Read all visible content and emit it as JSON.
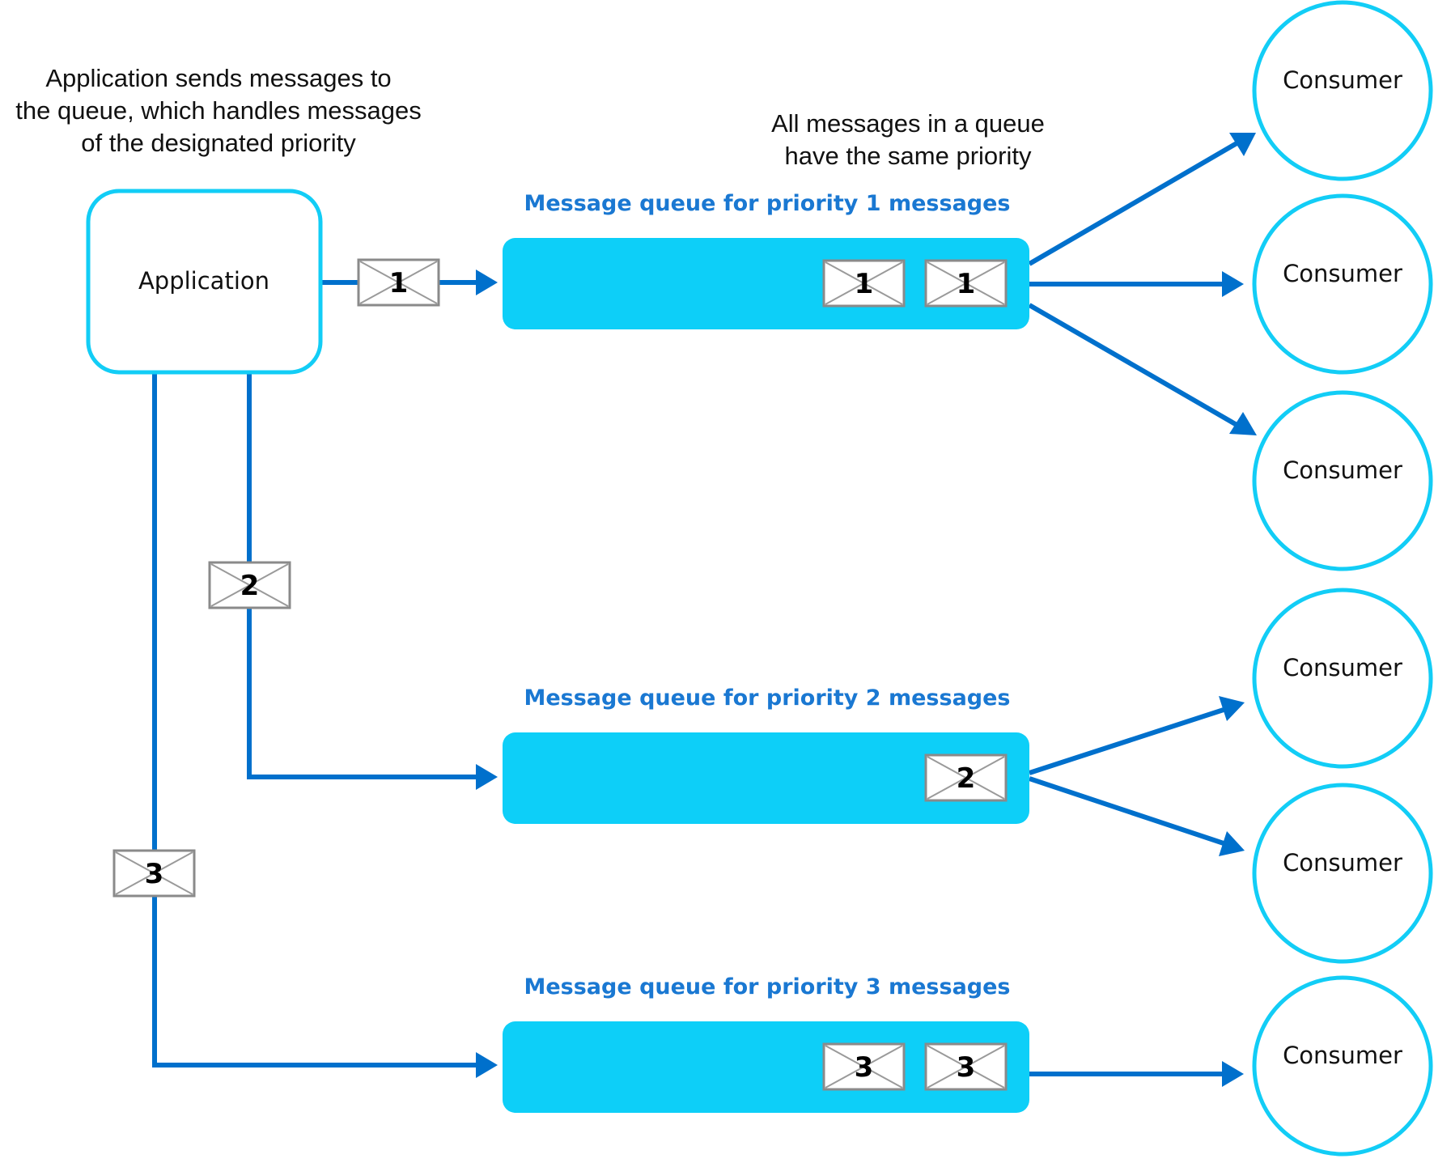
{
  "notes": {
    "application_note": [
      "Application sends messages to",
      "the queue, which handles messages",
      "of the designated priority"
    ],
    "queue_note": [
      "All messages in a queue",
      "have the same priority"
    ]
  },
  "application": {
    "label": "Application"
  },
  "queues": [
    {
      "label": "Message queue for priority 1 messages",
      "priority": "1",
      "messages": [
        "1",
        "1"
      ]
    },
    {
      "label": "Message queue for priority 2 messages",
      "priority": "2",
      "messages": [
        "2"
      ]
    },
    {
      "label": "Message queue for priority 3 messages",
      "priority": "3",
      "messages": [
        "3",
        "3"
      ]
    }
  ],
  "in_transit_messages": [
    {
      "priority": "1",
      "to_queue": 1
    },
    {
      "priority": "2",
      "to_queue": 2
    },
    {
      "priority": "3",
      "to_queue": 3
    }
  ],
  "consumers": [
    {
      "label": "Consumer",
      "queue": 1
    },
    {
      "label": "Consumer",
      "queue": 1
    },
    {
      "label": "Consumer",
      "queue": 1
    },
    {
      "label": "Consumer",
      "queue": 2
    },
    {
      "label": "Consumer",
      "queue": 2
    },
    {
      "label": "Consumer",
      "queue": 3
    }
  ],
  "colors": {
    "connector": "#0070cc",
    "queue_fill": "#0dcff8",
    "outline": "#12cdf6",
    "queue_label": "#1a78d2"
  }
}
